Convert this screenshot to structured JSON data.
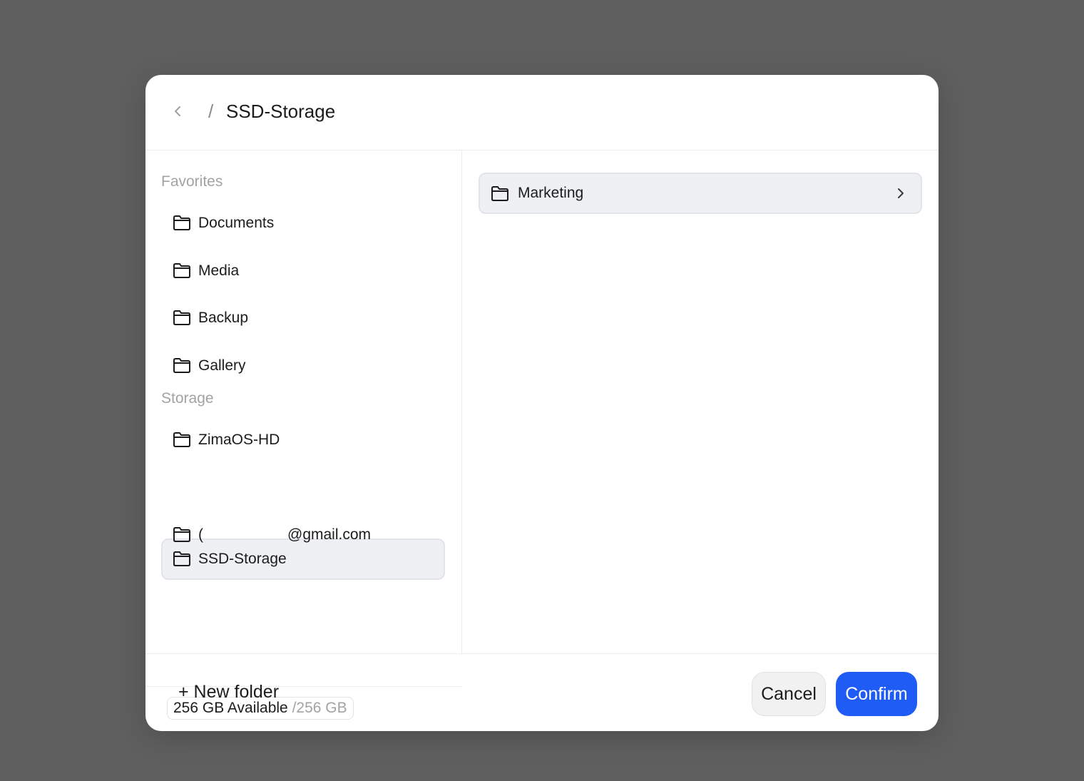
{
  "header": {
    "back_icon": "chevron-left-icon",
    "separator": "/",
    "title": "SSD-Storage"
  },
  "sidebar": {
    "favorites_label": "Favorites",
    "favorites": [
      {
        "label": "Documents",
        "icon": "folder-icon"
      },
      {
        "label": "Media",
        "icon": "folder-icon"
      },
      {
        "label": "Backup",
        "icon": "folder-icon"
      },
      {
        "label": "Gallery",
        "icon": "folder-icon"
      }
    ],
    "storage_label": "Storage",
    "storage": [
      {
        "label": "ZimaOS-HD",
        "icon": "folder-icon",
        "selected": false
      },
      {
        "label": "SSD-Storage",
        "icon": "folder-icon",
        "selected": true
      },
      {
        "label_prefix": "(",
        "label_suffix": "@gmail.com",
        "icon": "folder-icon",
        "selected": false
      }
    ],
    "capacity": {
      "available": "256 GB Available",
      "total": " /256 GB"
    }
  },
  "content": {
    "folders": [
      {
        "label": "Marketing",
        "icon": "folder-icon",
        "chevron": "chevron-right-icon"
      }
    ]
  },
  "footer": {
    "new_folder": "+ New folder",
    "cancel": "Cancel",
    "confirm": "Confirm"
  },
  "colors": {
    "overlay": "#5f5f5f",
    "accent": "#1f5cf6",
    "selected_bg": "#eef0f3"
  }
}
